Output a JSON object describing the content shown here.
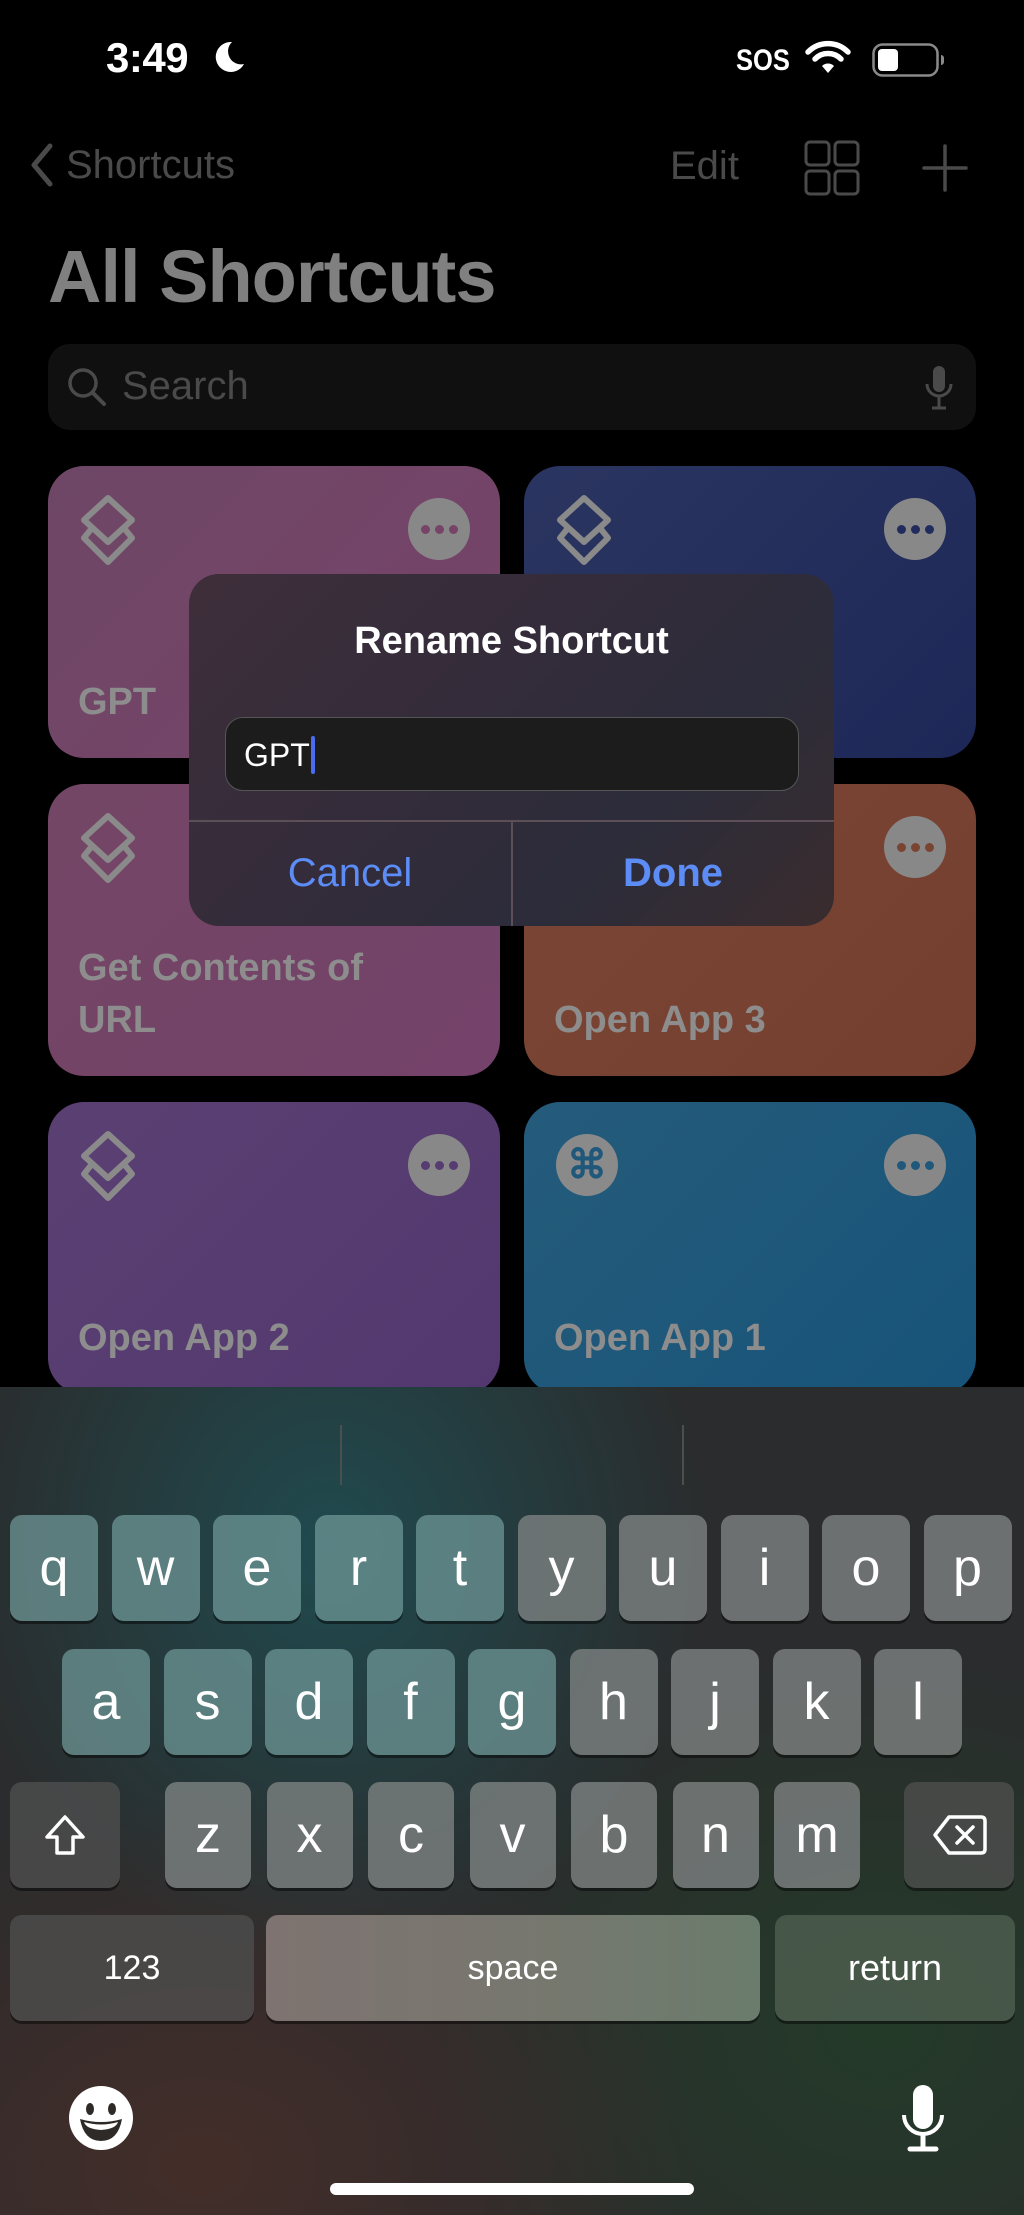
{
  "status_bar": {
    "time": "3:49",
    "focus_icon": "moon-icon",
    "carrier": "SOS",
    "wifi_icon": "wifi-icon",
    "battery_level_percent": 30
  },
  "nav": {
    "back_label": "Shortcuts",
    "edit_label": "Edit",
    "grid_icon": "grid-icon",
    "add_icon": "plus-icon"
  },
  "page": {
    "title": "All Shortcuts",
    "search_placeholder": "Search"
  },
  "shortcuts": [
    {
      "name": "GPT",
      "icon": "layers-icon",
      "color": "#774369",
      "dot_color": "#774369"
    },
    {
      "name": "",
      "icon": "layers-icon",
      "color": "#222c5c",
      "dot_color": "#222c5c"
    },
    {
      "name": "Get Contents of URL",
      "icon": "layers-icon",
      "color": "#744468",
      "dot_color": "#744468"
    },
    {
      "name": "Open App 3",
      "icon": "layers-icon",
      "color": "#7a4433",
      "dot_color": "#7a4433"
    },
    {
      "name": "Open App 2",
      "icon": "layers-icon",
      "color": "#563c71",
      "dot_color": "#563c71"
    },
    {
      "name": "Open App 1",
      "icon": "command-icon",
      "icon_glyph": "⌘",
      "color": "#1f587a",
      "dot_color": "#1f587a"
    }
  ],
  "dialog": {
    "title": "Rename Shortcut",
    "field_value": "GPT",
    "cancel_label": "Cancel",
    "done_label": "Done",
    "accent_color": "#5c8cf6"
  },
  "keyboard": {
    "row1": [
      "q",
      "w",
      "e",
      "r",
      "t",
      "y",
      "u",
      "i",
      "o",
      "p"
    ],
    "row2": [
      "a",
      "s",
      "d",
      "f",
      "g",
      "h",
      "j",
      "k",
      "l"
    ],
    "row3": [
      "z",
      "x",
      "c",
      "v",
      "b",
      "n",
      "m"
    ],
    "numbers_label": "123",
    "space_label": "space",
    "return_label": "return"
  }
}
